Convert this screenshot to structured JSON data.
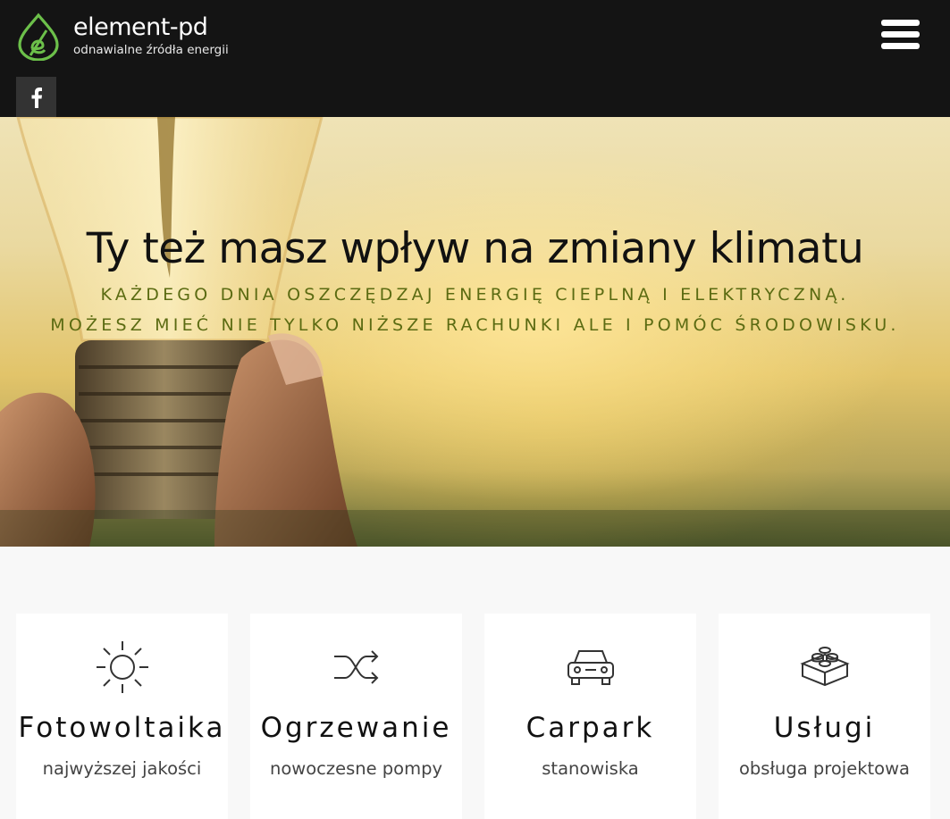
{
  "brand": {
    "name": "element-pd",
    "tagline": "odnawialne źródła energii",
    "logo_color": "#6cc04a"
  },
  "header": {
    "menu_icon": "hamburger-icon",
    "social": {
      "icon": "facebook-icon"
    }
  },
  "hero": {
    "title": "Ty też masz wpływ na zmiany klimatu",
    "subtitle_line1": "KAŻDEGO DNIA OSZCZĘDZAJ ENERGIĘ CIEPLNĄ I ELEKTRYCZNĄ.",
    "subtitle_line2": "MOŻESZ MIEĆ NIE TYLKO NIŻSZE RACHUNKI ALE I POMÓC ŚRODOWISKU.",
    "subtitle_color": "#5b6b12"
  },
  "cards": [
    {
      "icon": "sun-icon",
      "title": "Fotowoltaika",
      "text": "najwyższej jakości"
    },
    {
      "icon": "shuffle-icon",
      "title": "Ogrzewanie",
      "text": "nowoczesne pompy"
    },
    {
      "icon": "car-icon",
      "title": "Carpark",
      "text": "stanowiska"
    },
    {
      "icon": "lego-brick-icon",
      "title": "Usługi",
      "text": "obsługa projektowa"
    }
  ]
}
